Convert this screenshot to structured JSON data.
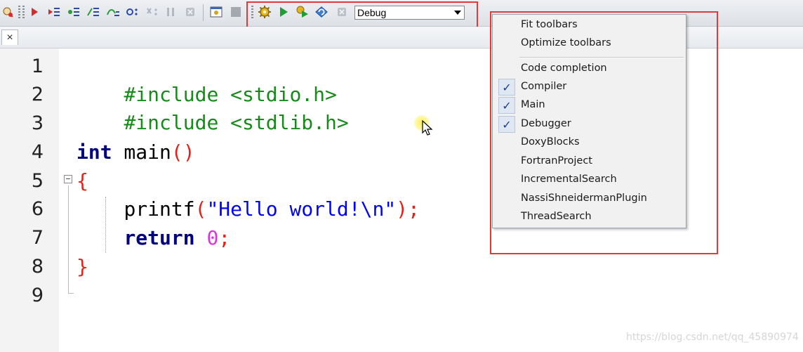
{
  "toolbar": {
    "build_target": "Debug",
    "icons": [
      "run-to-cursor-icon",
      "debug-start-icon",
      "next-line-icon",
      "step-into-icon",
      "step-out-icon",
      "next-instruction-icon",
      "step-into-instruction-icon",
      "break-icon",
      "stop-debugger-icon",
      "debug-windows-icon",
      "various-info-icon",
      "build-icon",
      "run-icon",
      "build-and-run-icon",
      "rebuild-icon",
      "abort-icon",
      "dropdown-arrow-icon"
    ]
  },
  "tabs": {
    "close_glyph": "×"
  },
  "editor": {
    "line_numbers": [
      "1",
      "2",
      "3",
      "4",
      "5",
      "6",
      "7",
      "8",
      "9"
    ],
    "lines": {
      "l1": {
        "directive": "#include <stdio.h>"
      },
      "l2": {
        "directive": "#include <stdlib.h>"
      },
      "l4": {
        "type": "int",
        "name": " main",
        "parens": "()"
      },
      "l5": {
        "brace": "{"
      },
      "l6": {
        "indent": "    ",
        "func": "printf",
        "open": "(",
        "str": "\"Hello world!\\n\"",
        "close": ")",
        "semi": ";"
      },
      "l7": {
        "indent": "    ",
        "kw": "return",
        "space": " ",
        "num": "0",
        "semi": ";"
      },
      "l8": {
        "brace": "}"
      }
    }
  },
  "context_menu": {
    "items_top": [
      "Fit toolbars",
      "Optimize toolbars"
    ],
    "items": [
      {
        "label": "Code completion",
        "checked": false
      },
      {
        "label": "Compiler",
        "checked": true
      },
      {
        "label": "Main",
        "checked": true
      },
      {
        "label": "Debugger",
        "checked": true
      },
      {
        "label": "DoxyBlocks",
        "checked": false
      },
      {
        "label": "FortranProject",
        "checked": false
      },
      {
        "label": "IncrementalSearch",
        "checked": false
      },
      {
        "label": "NassiShneidermanPlugin",
        "checked": false
      },
      {
        "label": "ThreadSearch",
        "checked": false
      }
    ],
    "check_glyph": "✓"
  },
  "watermark": "https://blog.csdn.net/qq_45890974",
  "colors": {
    "preprocessor": "#178a1b",
    "keyword": "#000080",
    "string": "#0000ff",
    "number": "#e033e0",
    "brace": "#e0231b",
    "annotation": "#e23a3a"
  }
}
